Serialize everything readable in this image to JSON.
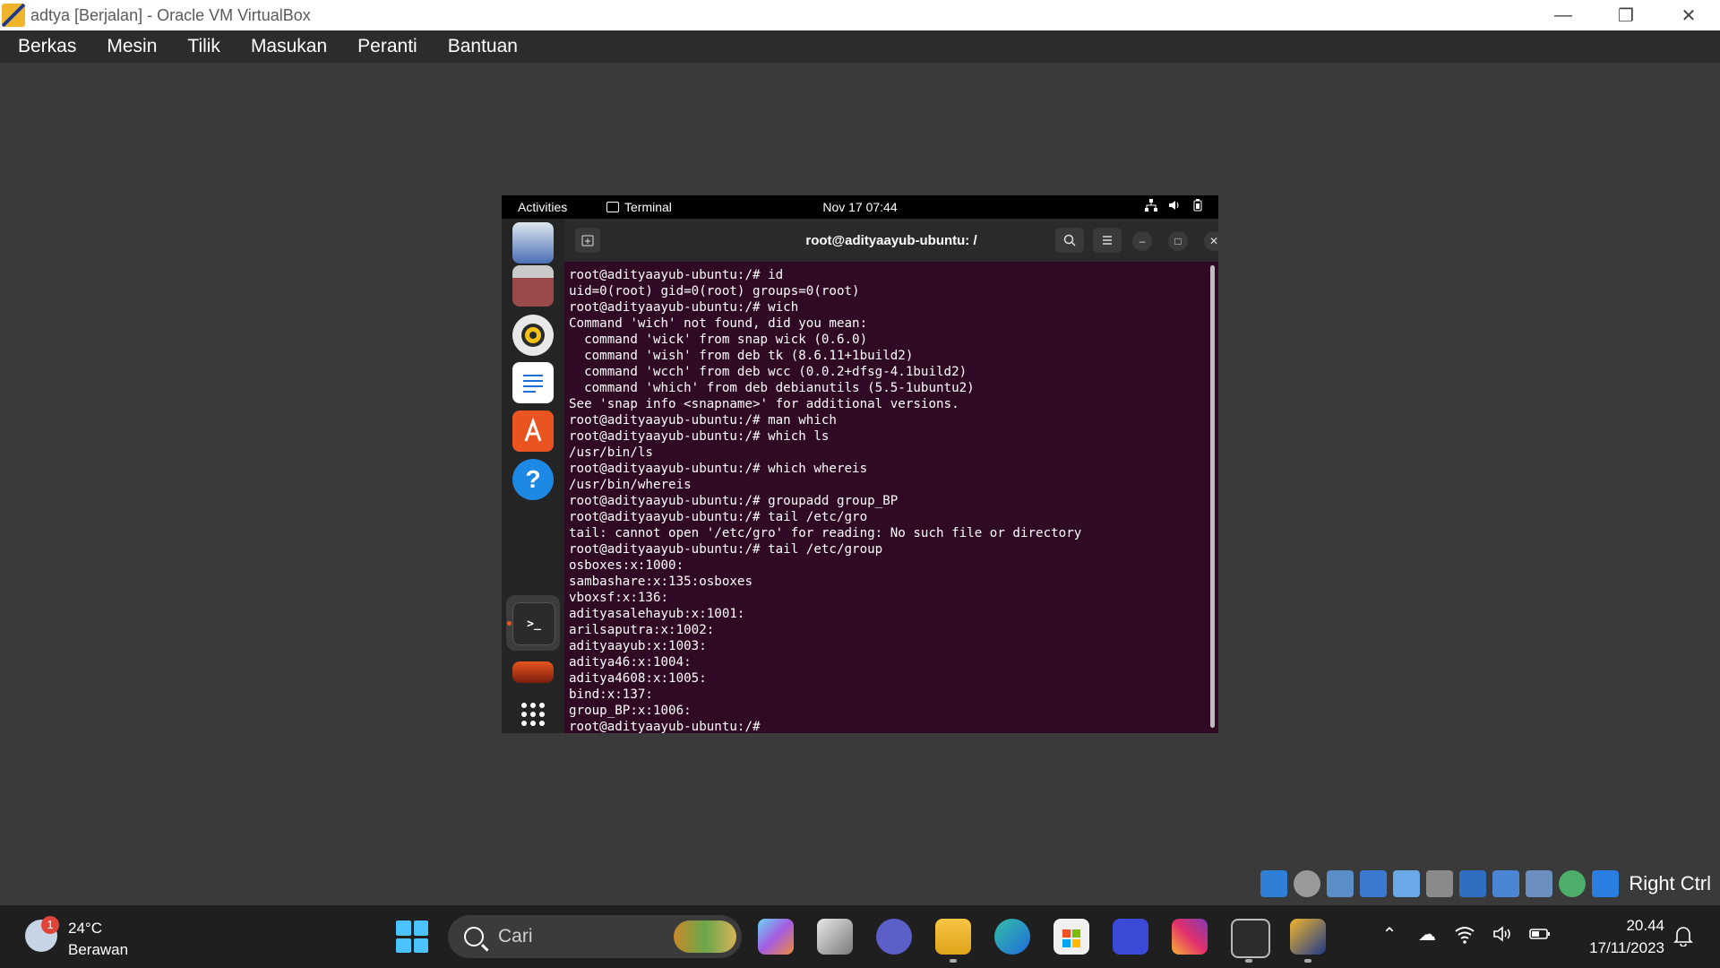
{
  "window": {
    "title": "adtya [Berjalan] - Oracle VM VirtualBox"
  },
  "menu": [
    "Berkas",
    "Mesin",
    "Tilik",
    "Masukan",
    "Peranti",
    "Bantuan"
  ],
  "guest": {
    "topbar": {
      "activities": "Activities",
      "app": "Terminal",
      "clock": "Nov 17  07:44"
    },
    "terminal": {
      "title": "root@adityaayub-ubuntu: /",
      "lines": [
        "root@adityaayub-ubuntu:/# id",
        "uid=0(root) gid=0(root) groups=0(root)",
        "root@adityaayub-ubuntu:/# wich",
        "Command 'wich' not found, did you mean:",
        "  command 'wick' from snap wick (0.6.0)",
        "  command 'wish' from deb tk (8.6.11+1build2)",
        "  command 'wcch' from deb wcc (0.0.2+dfsg-4.1build2)",
        "  command 'which' from deb debianutils (5.5-1ubuntu2)",
        "See 'snap info <snapname>' for additional versions.",
        "root@adityaayub-ubuntu:/# man which",
        "root@adityaayub-ubuntu:/# which ls",
        "/usr/bin/ls",
        "root@adityaayub-ubuntu:/# which whereis",
        "/usr/bin/whereis",
        "root@adityaayub-ubuntu:/# groupadd group_BP",
        "root@adityaayub-ubuntu:/# tail /etc/gro",
        "tail: cannot open '/etc/gro' for reading: No such file or directory",
        "root@adityaayub-ubuntu:/# tail /etc/group",
        "osboxes:x:1000:",
        "sambashare:x:135:osboxes",
        "vboxsf:x:136:",
        "adityasalehayub:x:1001:",
        "arilsaputra:x:1002:",
        "adityaayub:x:1003:",
        "aditya46:x:1004:",
        "aditya4608:x:1005:",
        "bind:x:137:",
        "group_BP:x:1006:",
        "root@adityaayub-ubuntu:/#"
      ]
    }
  },
  "statusbar": {
    "host_key": "Right Ctrl"
  },
  "taskbar": {
    "weather": {
      "temp": "24°C",
      "condition": "Berawan",
      "badge": "1"
    },
    "search_placeholder": "Cari",
    "time": "20.44",
    "date": "17/11/2023"
  },
  "colors": {
    "terminal_bg": "#300a24",
    "ubuntu_orange": "#e95420",
    "win_accent": "#4cc2ff"
  }
}
